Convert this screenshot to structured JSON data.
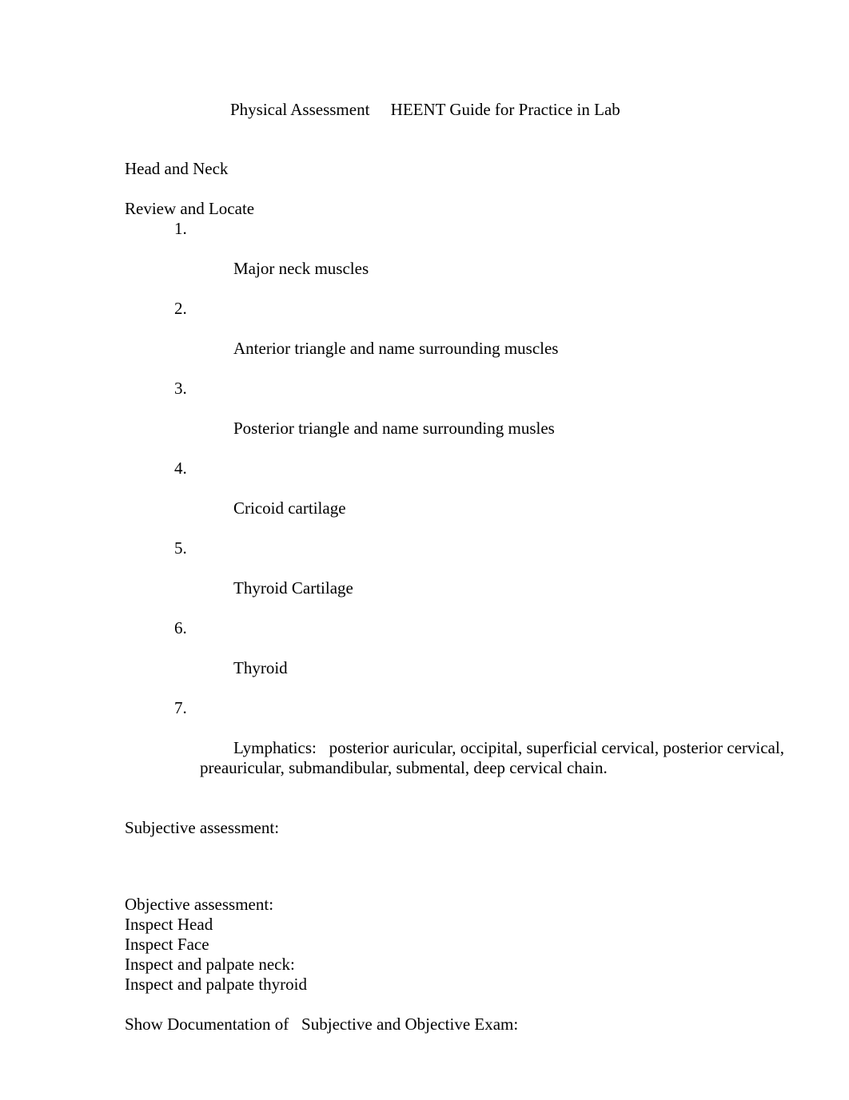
{
  "document": {
    "title": "Physical Assessment     HEENT Guide for Practice in Lab",
    "sections": {
      "head_and_neck_heading": "Head and Neck",
      "review_heading": "Review and Locate",
      "review_items": [
        "Major neck muscles",
        "Anterior triangle and name surrounding muscles",
        "Posterior triangle and name surrounding musles",
        "Cricoid cartilage",
        "Thyroid Cartilage",
        "Thyroid",
        "Lymphatics:   posterior auricular, occipital, superficial cervical, posterior cervical,  preauricular, submandibular, submental, deep cervical chain."
      ],
      "review_item_markers": [
        "1.",
        "2.",
        "3.",
        "4.",
        "5.",
        "6.",
        "7."
      ],
      "subjective_assessment_label": "Subjective assessment:",
      "objective_assessment_label": "Objective assessment:",
      "objective_steps": [
        "Inspect Head",
        "Inspect Face",
        "Inspect and palpate neck:",
        "Inspect and palpate thyroid"
      ],
      "documentation_line": "Show Documentation of   Subjective and Objective Exam:"
    }
  },
  "style": {
    "page_background": "#ffffff",
    "text_color": "#000000"
  }
}
